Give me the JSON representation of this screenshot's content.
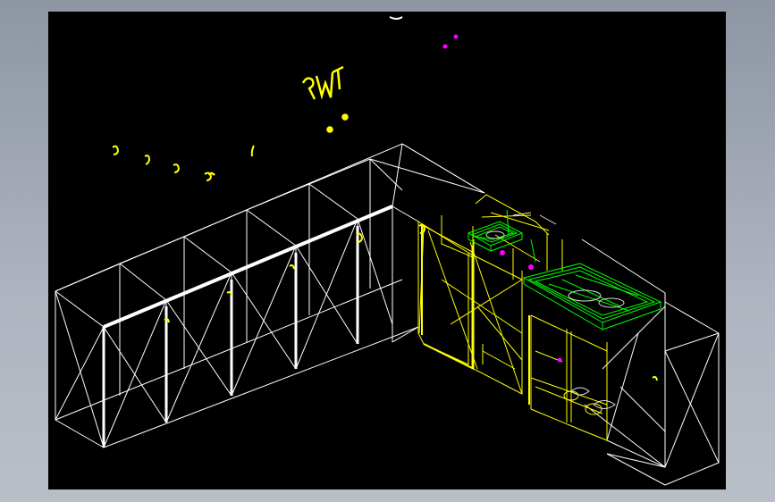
{
  "viewer": {
    "background_color": "#000000",
    "frame_color": "#a3aab5",
    "line_colors": {
      "cabinets": "#ffffff",
      "appliances": "#ffff00",
      "sink_and_counter": "#00ff00",
      "markers": "#ff00ff"
    },
    "annotation_text": "TNT"
  }
}
